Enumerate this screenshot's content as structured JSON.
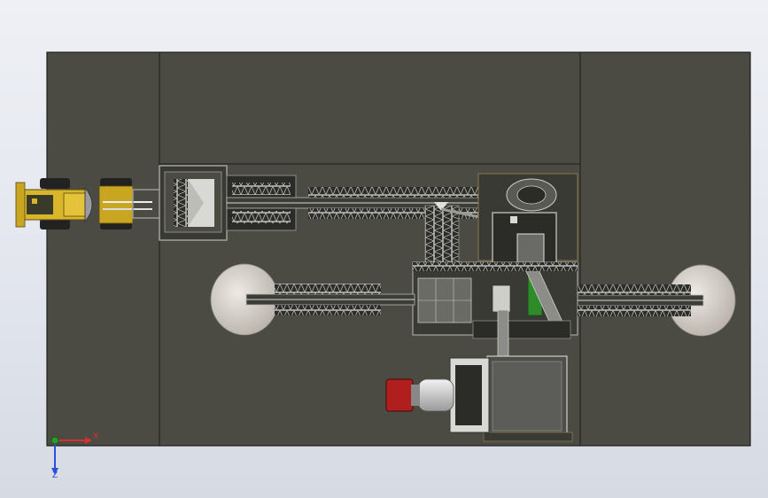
{
  "viewport": {
    "background_top": "#eef0f5",
    "background_bottom": "#d6dae3"
  },
  "model": {
    "ground_color": "#4b4b43",
    "outline_color": "#1e1e1a",
    "conveyor_color": "#2b2b28",
    "truss_color": "#b9b9b4",
    "steel_color": "#8c8c88",
    "dome_color": "#d9d5cf",
    "loader_yellow": "#d9b52a",
    "green_panel": "#2f8a2a",
    "red_tank": "#b01e1e"
  },
  "triad": {
    "x_label": "X",
    "y_label": "Z",
    "x_color": "#d43030",
    "y_color": "#2850d8",
    "origin_color": "#2a9a2a"
  }
}
